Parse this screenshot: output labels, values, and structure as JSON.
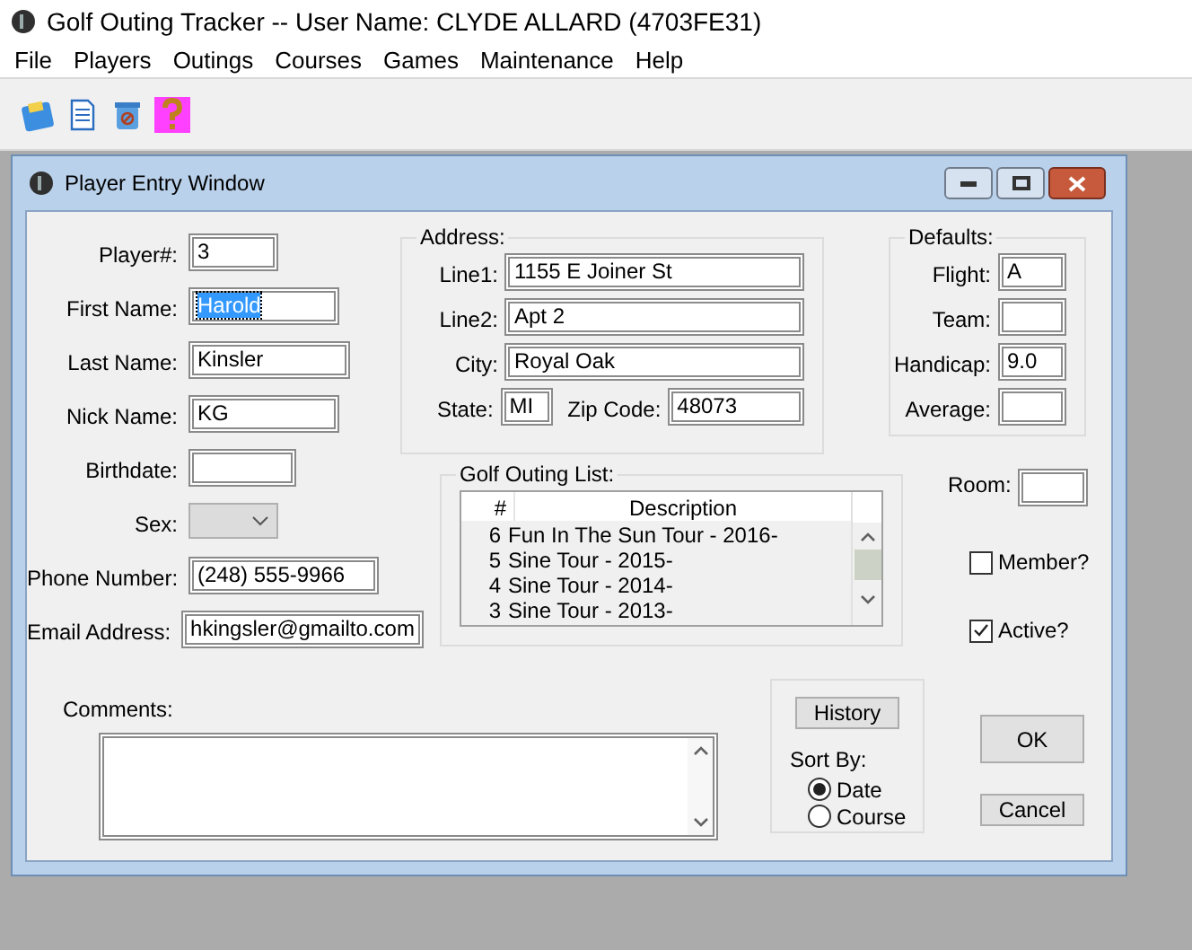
{
  "app": {
    "title": "Golf Outing Tracker -- User Name: CLYDE ALLARD (4703FE31)"
  },
  "menu": [
    "File",
    "Players",
    "Outings",
    "Courses",
    "Games",
    "Maintenance",
    "Help"
  ],
  "dialog": {
    "title": "Player Entry Window",
    "player_fields": [
      {
        "label": "Player#:",
        "kind": "text",
        "value": "3",
        "value_selected": false
      },
      {
        "label": "First Name:",
        "kind": "text",
        "value": "Harold",
        "value_selected": true
      },
      {
        "label": "Last Name:",
        "kind": "text",
        "value": "Kinsler",
        "value_selected": false
      },
      {
        "label": "Nick Name:",
        "kind": "text",
        "value": "KG",
        "value_selected": false
      },
      {
        "label": "Birthdate:",
        "kind": "text",
        "value_selected": false
      },
      {
        "label": "Sex:",
        "kind": "dropdown",
        "value_selected": false
      },
      {
        "label": "Phone Number:",
        "kind": "text",
        "value": "(248) 555-9966",
        "value_selected": false
      },
      {
        "label": "Email Address:",
        "kind": "text",
        "value": "hkingsler@gmailto.com",
        "value_selected": false
      }
    ],
    "address": {
      "legend": "Address:",
      "fields": [
        {
          "label": "Line1:",
          "value": "1155 E Joiner St"
        },
        {
          "label": "Line2:",
          "value": "Apt 2"
        },
        {
          "label": "City:",
          "value": "Royal Oak"
        }
      ],
      "state": {
        "label": "State:",
        "value": "MI"
      },
      "zip": {
        "label": "Zip Code:",
        "value": "48073"
      }
    },
    "defaults": {
      "legend": "Defaults:",
      "fields": [
        {
          "label": "Flight:",
          "value": "A"
        },
        {
          "label": "Team:"
        },
        {
          "label": "Handicap:",
          "value": "9.0"
        },
        {
          "label": "Average:"
        }
      ]
    },
    "outing_list": {
      "legend": "Golf Outing List:",
      "columns": [
        "#",
        "Description"
      ],
      "rows": [
        {
          "number": "6",
          "description": "Fun In The Sun Tour - 2016-"
        },
        {
          "number": "5",
          "description": "Sine Tour - 2015-"
        },
        {
          "number": "4",
          "description": "Sine Tour - 2014-"
        },
        {
          "number": "3",
          "description": "Sine Tour - 2013-"
        }
      ]
    },
    "room": {
      "label": "Room:"
    },
    "checkboxes": [
      {
        "label": "Member?",
        "checked": false
      },
      {
        "label": "Active?",
        "checked": true
      }
    ],
    "comments": {
      "label": "Comments:"
    },
    "history_button": "History",
    "sort_by": {
      "label": "Sort By:",
      "options": [
        {
          "label": "Date",
          "selected": true
        },
        {
          "label": "Course",
          "selected": false
        }
      ]
    },
    "buttons": [
      "OK",
      "Cancel"
    ]
  }
}
